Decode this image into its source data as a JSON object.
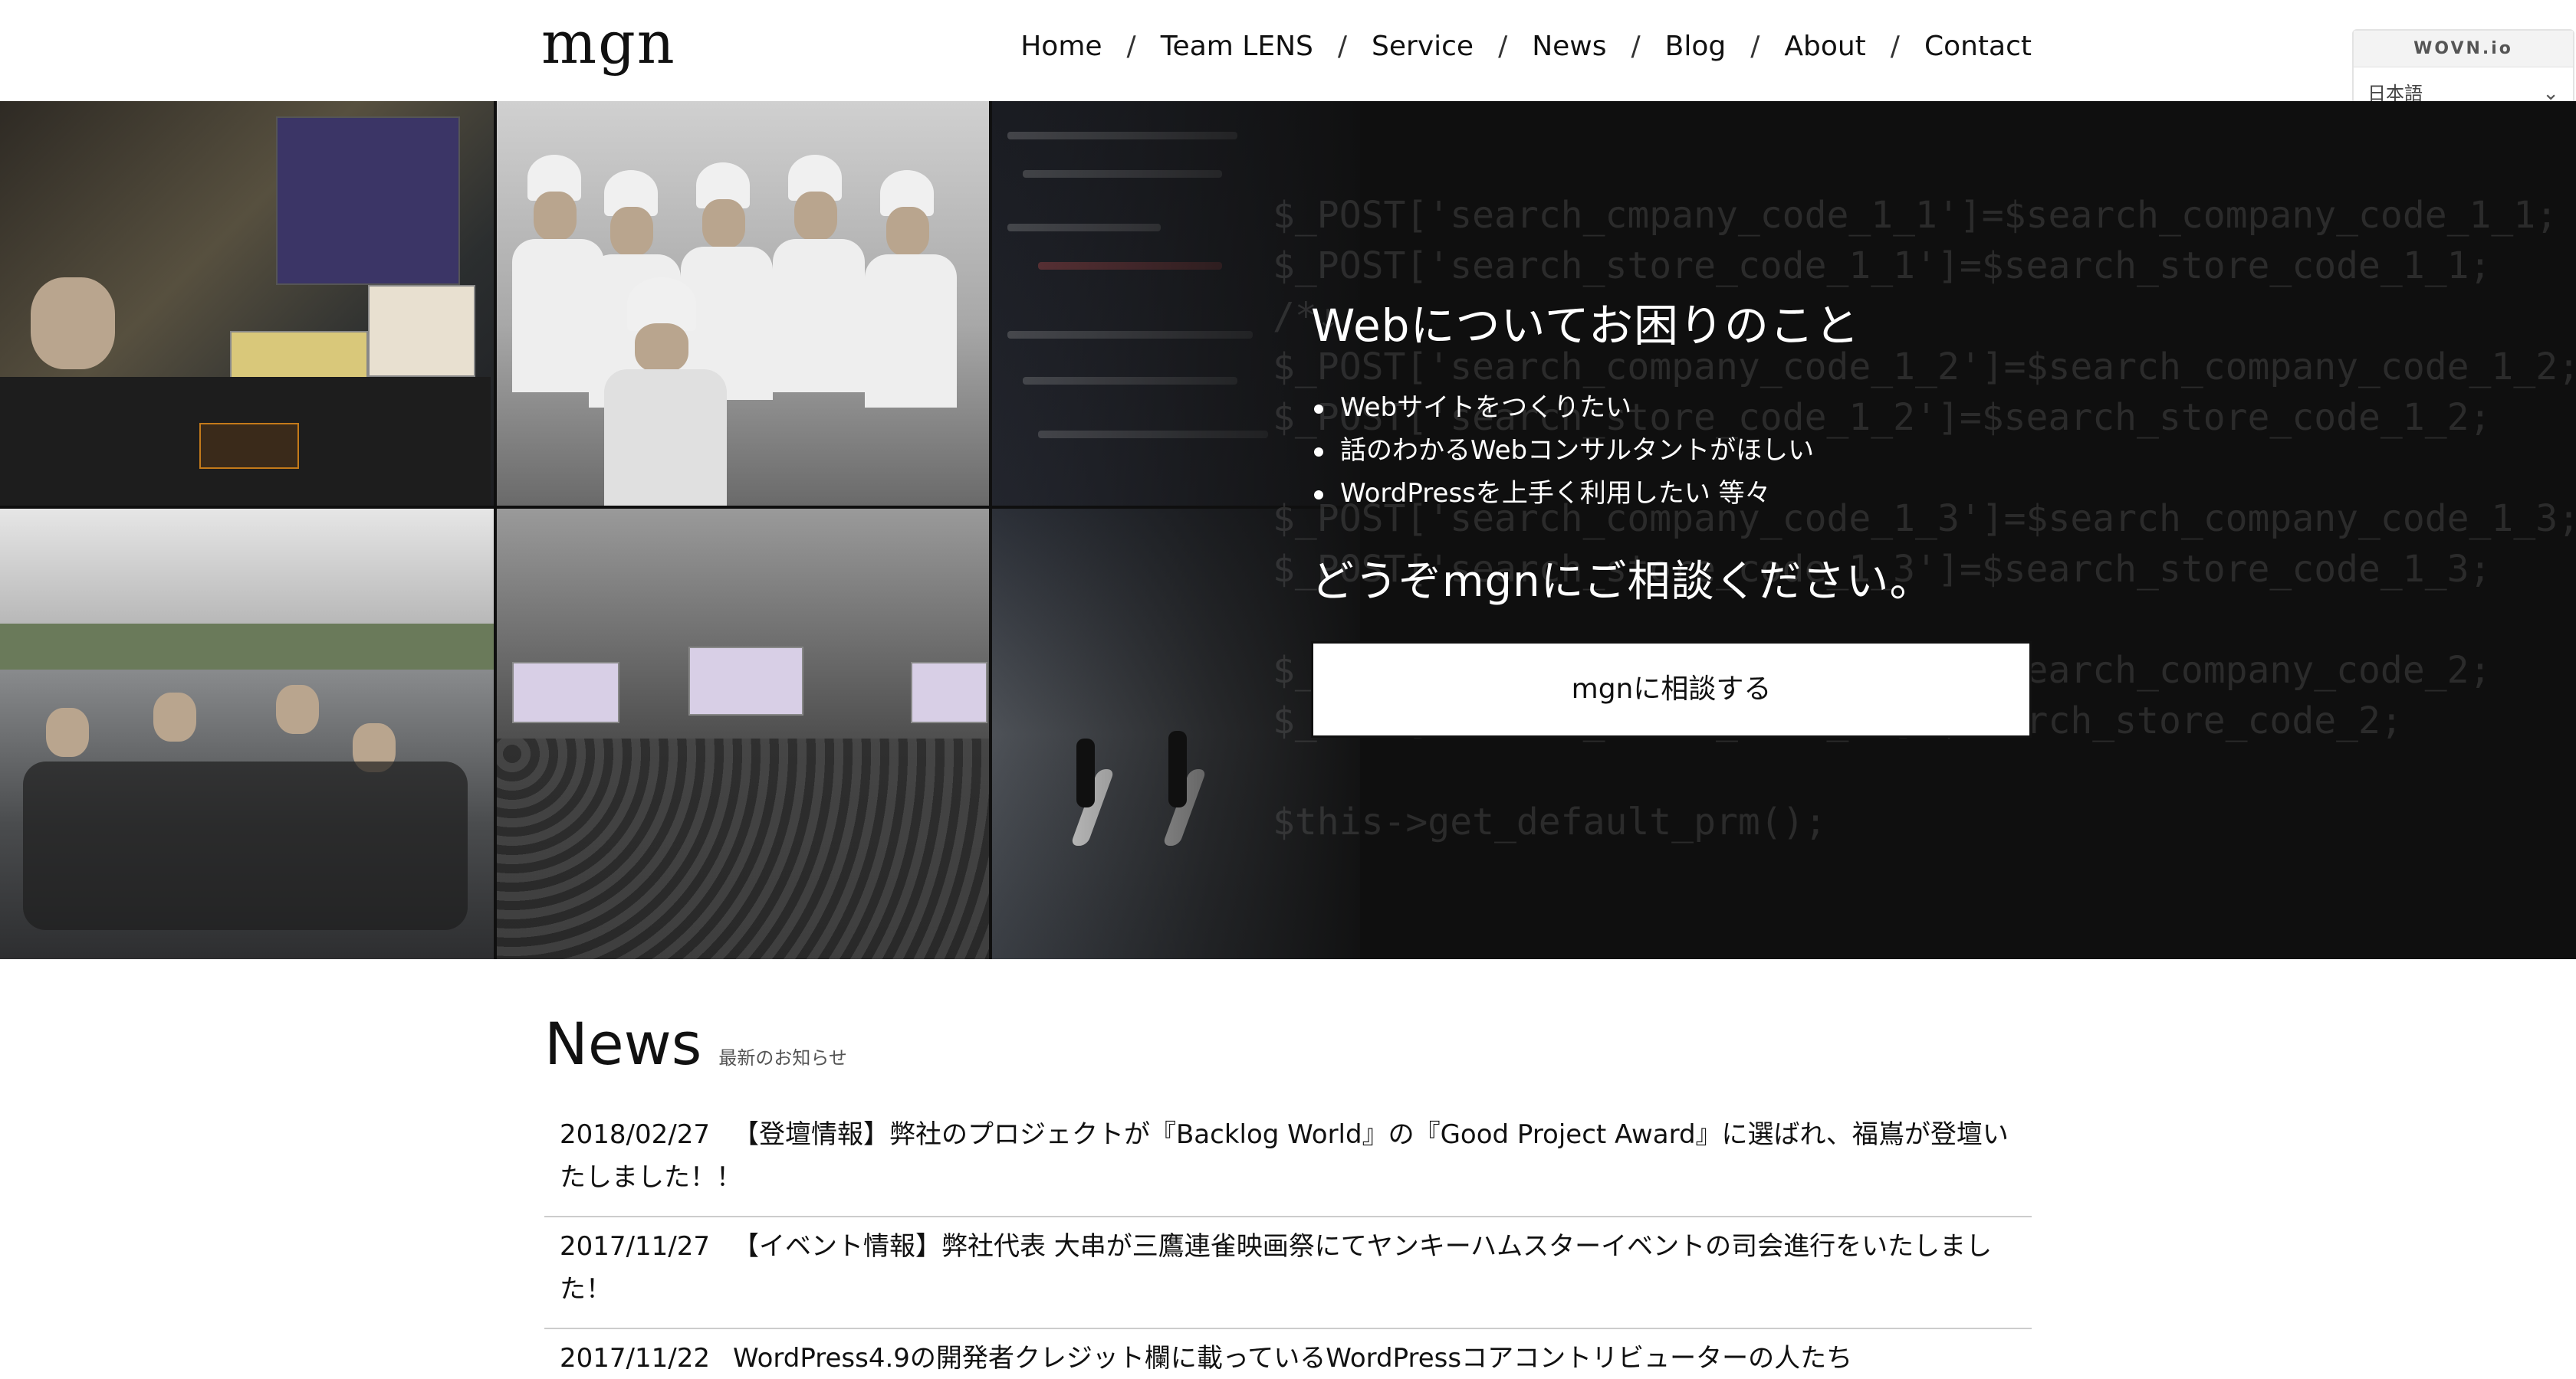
{
  "header": {
    "logo": "mgn",
    "nav": [
      "Home",
      "Team LENS",
      "Service",
      "News",
      "Blog",
      "About",
      "Contact"
    ],
    "separator": "/"
  },
  "language_widget": {
    "brand": "WOVN.io",
    "selected": "日本語",
    "chevron_icon": "chevron-down-icon"
  },
  "hero": {
    "heading": "Webについてお困りのこと",
    "list": [
      "Webサイトをつくりたい",
      "話のわかるWebコンサルタントがほしい",
      "WordPressを上手く利用したい 等々"
    ],
    "subheading": "どうぞmgnにご相談ください。",
    "cta_label": "mgnに相談する",
    "code_lines": [
      "$_POST['search_cmpany_code_1_1']=$search_company_code_1_1;",
      "$_POST['search_store_code_1_1']=$search_store_code_1_1;",
      "/*↓",
      "$_POST['search_company_code_1_2']=$search_company_code_1_2;",
      "$_POST['search_store_code_1_2']=$search_store_code_1_2;",
      "",
      "$_POST['search_company_code_1_3']=$search_company_code_1_3;",
      "$_POST['search_store_code_1_3']=$search_store_code_1_3;",
      "",
      "$_POST['search_company_code_2']=$search_company_code_2;",
      "$_POST['search_store_code_2']=$search_store_code_2;",
      "",
      "$this->get_default_prm();"
    ]
  },
  "news": {
    "title": "News",
    "subtitle": "最新のお知らせ",
    "items": [
      {
        "date": "2018/02/27",
        "text": "【登壇情報】弊社のプロジェクトが『Backlog World』の『Good Project Award』に選ばれ、福嶌が登壇いたしました！！"
      },
      {
        "date": "2017/11/27",
        "text": "【イベント情報】弊社代表 大串が三鷹連雀映画祭にてヤンキーハムスターイベントの司会進行をいたしました！"
      },
      {
        "date": "2017/11/22",
        "text": "WordPress4.9の開発者クレジット欄に載っているWordPressコアコントリビューターの人たち"
      }
    ]
  }
}
